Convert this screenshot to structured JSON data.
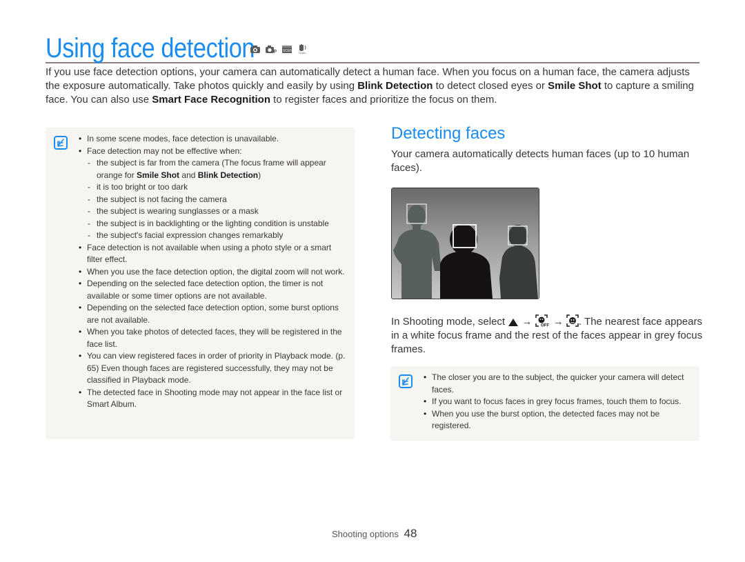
{
  "page": {
    "title": "Using face detection",
    "mode_icons": [
      "camera-icon",
      "program-camera-icon",
      "scene-icon",
      "dual-is-icon"
    ],
    "intro": {
      "p1": "If you use face detection options, your camera can automatically detect a human face. When you focus on a human face, the camera adjusts the exposure automatically. Take photos quickly and easily by using ",
      "b1": "Blink Detection",
      "p2": " to detect closed eyes or ",
      "b2": "Smile Shot",
      "p3": " to capture a smiling face. You can also use ",
      "b3": "Smart Face Recognition",
      "p4": " to register faces and prioritize the focus on them."
    },
    "left_note": {
      "icon": "note-icon",
      "items": [
        {
          "type": "bullet",
          "text": "In some scene modes, face detection is unavailable."
        },
        {
          "type": "bullet",
          "text": "Face detection may not be effective when:"
        },
        {
          "type": "dash",
          "pre": "the subject is far from the camera (The focus frame will appear orange for ",
          "b1": "Smile Shot",
          "mid": " and ",
          "b2": "Blink Detection",
          "post": ")"
        },
        {
          "type": "dash",
          "text": "it is too bright or too dark"
        },
        {
          "type": "dash",
          "text": "the subject is not facing the camera"
        },
        {
          "type": "dash",
          "text": "the subject is wearing sunglasses or a mask"
        },
        {
          "type": "dash",
          "text": "the subject is in backlighting or the lighting condition is unstable"
        },
        {
          "type": "dash",
          "text": "the subject's facial expression changes remarkably"
        },
        {
          "type": "bullet",
          "text": "Face detection is not available when using a photo style or a smart filter effect."
        },
        {
          "type": "bullet",
          "text": "When you use the face detection option, the digital zoom will not work."
        },
        {
          "type": "bullet",
          "text": "Depending on the selected face detection option, the timer is not available or some timer options are not available."
        },
        {
          "type": "bullet",
          "text": "Depending on the selected face detection option, some burst options are not available."
        },
        {
          "type": "bullet",
          "text": "When you take photos of detected faces, they will be registered in the face list."
        },
        {
          "type": "bullet",
          "text": "You can view registered faces in order of priority in Playback mode. (p. 65) Even though faces are registered successfully, they may not be classified in Playback mode."
        },
        {
          "type": "bullet",
          "text": "The detected face in Shooting mode may not appear in the face list or Smart Album."
        }
      ]
    },
    "section": {
      "heading": "Detecting faces",
      "description": "Your camera automatically detects human faces (up to 10 human faces).",
      "illustration": "face-detection-illustration",
      "instruction": {
        "pre": "In Shooting mode, select",
        "arrow": "→",
        "post": ". The nearest face appears in a white focus frame and the rest of the faces appear in grey focus frames.",
        "icons": [
          "menu-up-icon",
          "face-detection-off-icon",
          "face-detection-normal-icon"
        ]
      }
    },
    "right_note": {
      "icon": "note-icon",
      "items": [
        {
          "type": "bullet",
          "text": "The closer you are to the subject, the quicker your camera will detect faces."
        },
        {
          "type": "bullet",
          "text": "If you want to focus faces in grey focus frames, touch them to focus."
        },
        {
          "type": "bullet",
          "text": "When you use the burst option, the detected faces may not be registered."
        }
      ]
    },
    "footer": {
      "section": "Shooting options",
      "page_number": "48"
    },
    "colors": {
      "accent": "#1a8cf0",
      "note_bg": "#f7f5f1",
      "rule": "#8a7d7b"
    }
  }
}
